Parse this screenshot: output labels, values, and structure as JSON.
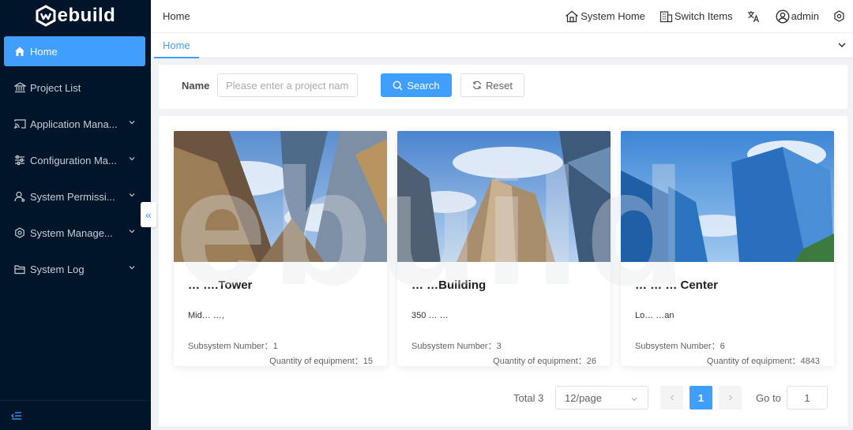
{
  "app": {
    "brand": "ebuild",
    "accent_color": "#409eff",
    "sidebar_bg": "#001529"
  },
  "sidebar": {
    "items": [
      {
        "label": "Home",
        "icon": "home-icon",
        "active": true
      },
      {
        "label": "Project List",
        "icon": "bank-icon"
      },
      {
        "label": "Application Mana...",
        "icon": "cast-icon"
      },
      {
        "label": "Configuration Ma...",
        "icon": "sliders-icon"
      },
      {
        "label": "System Permissi...",
        "icon": "user-icon"
      },
      {
        "label": "System Manage...",
        "icon": "gear-icon"
      },
      {
        "label": "System Log",
        "icon": "folder-icon"
      }
    ]
  },
  "header": {
    "breadcrumb": "Home",
    "system_home": "System Home",
    "switch_items": "Switch Items",
    "user": "admin"
  },
  "tabs": [
    {
      "label": "Home",
      "active": true
    }
  ],
  "search": {
    "name_label": "Name",
    "placeholder": "Please enter a project name",
    "search_label": "Search",
    "reset_label": "Reset"
  },
  "watermark": "ebuild",
  "projects": [
    {
      "title": "… ….Tower",
      "address": "Mid… …,",
      "subsystem": "Subsystem Number：1",
      "equipment": "Quantity of equipment：15"
    },
    {
      "title": "… …Building",
      "address": "350 … …",
      "subsystem": "Subsystem Number：3",
      "equipment": "Quantity of equipment：26"
    },
    {
      "title": "… … … Center",
      "address": "Lo… …an",
      "subsystem": "Subsystem Number：6",
      "equipment": "Quantity of equipment：4843"
    }
  ],
  "pagination": {
    "total": "Total 3",
    "page_size": "12/page",
    "current_page": "1",
    "goto_label": "Go to",
    "goto_value": "1"
  }
}
